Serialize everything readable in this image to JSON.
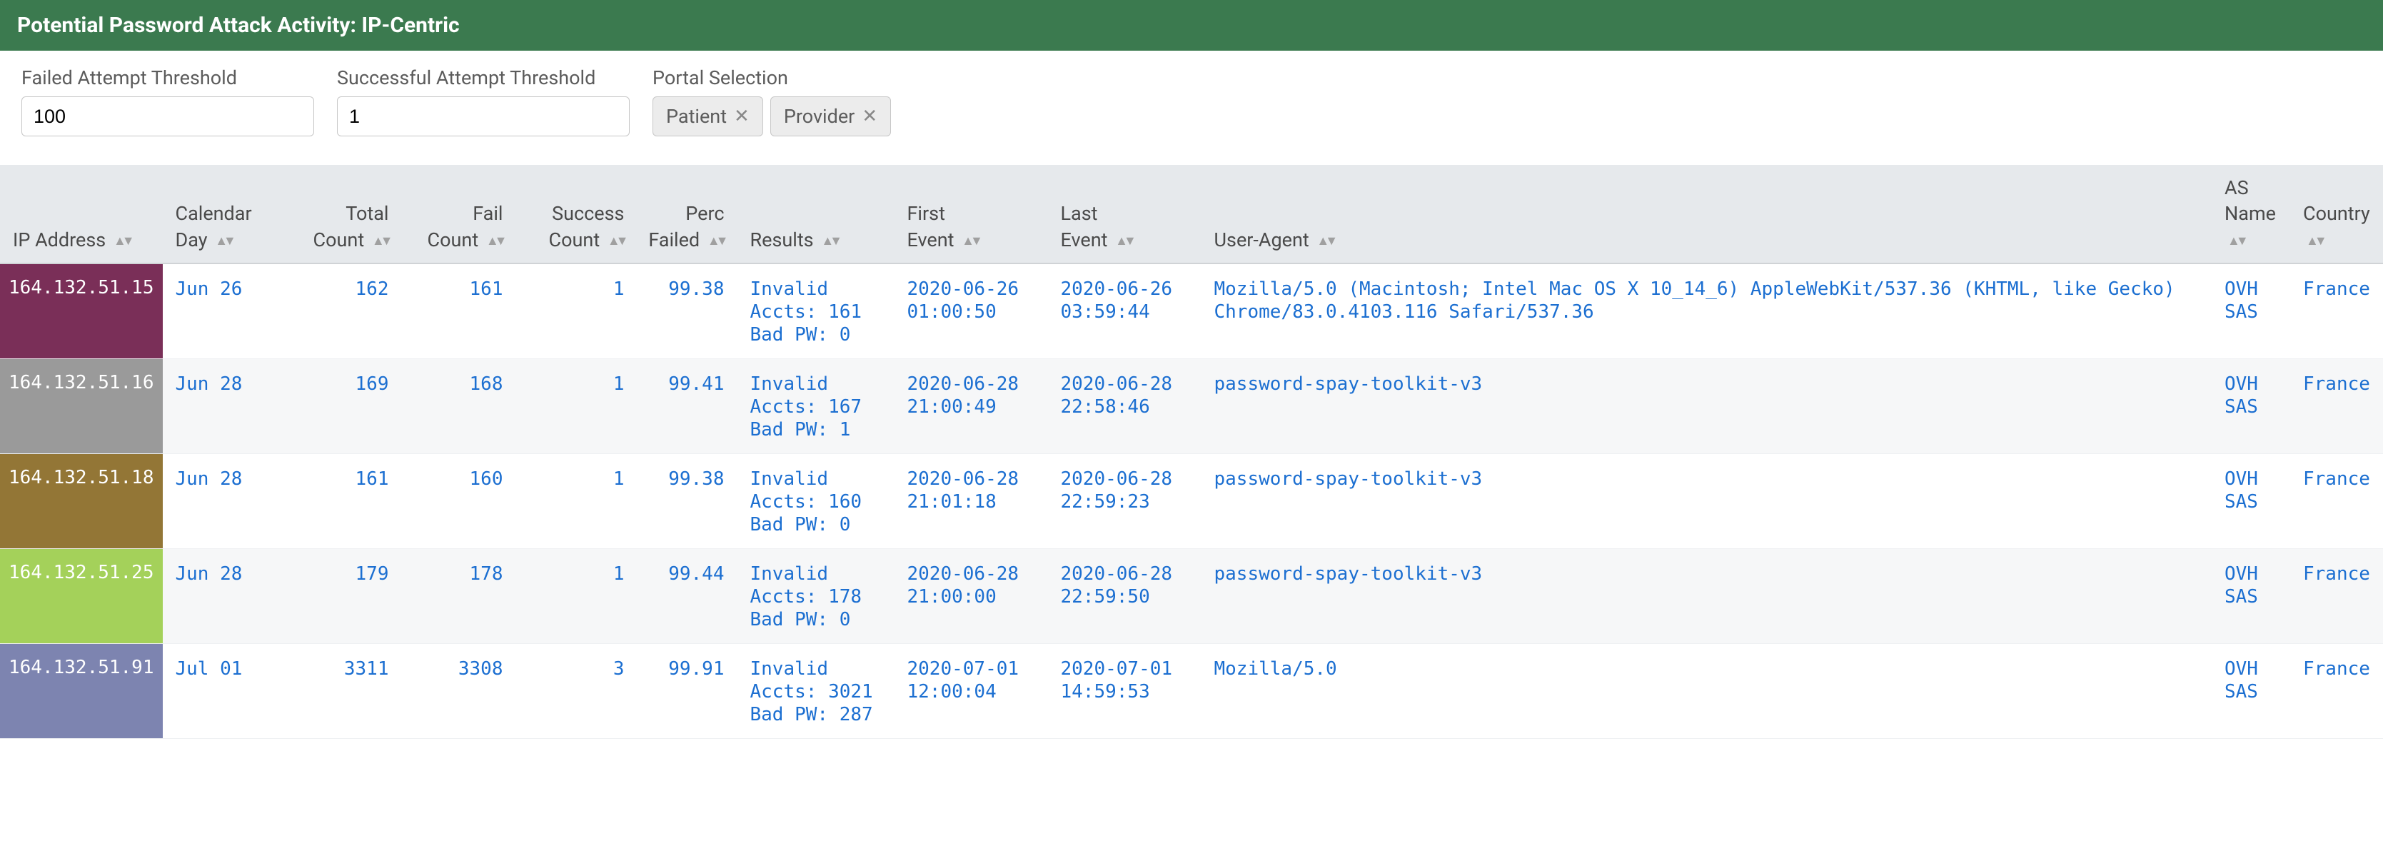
{
  "header": {
    "title": "Potential Password Attack Activity: IP-Centric"
  },
  "filters": {
    "failed": {
      "label": "Failed Attempt Threshold",
      "value": "100"
    },
    "successful": {
      "label": "Successful Attempt Threshold",
      "value": "1"
    },
    "portal": {
      "label": "Portal Selection",
      "chips": [
        {
          "label": "Patient"
        },
        {
          "label": "Provider"
        }
      ]
    }
  },
  "columns": [
    {
      "key": "ip",
      "label": "IP Address",
      "align": "left"
    },
    {
      "key": "day",
      "label": "Calendar Day",
      "align": "left"
    },
    {
      "key": "total",
      "label": "Total Count",
      "align": "right"
    },
    {
      "key": "fail",
      "label": "Fail Count",
      "align": "right"
    },
    {
      "key": "success",
      "label": "Success Count",
      "align": "right"
    },
    {
      "key": "perc",
      "label": "Perc Failed",
      "align": "right"
    },
    {
      "key": "results",
      "label": "Results",
      "align": "left"
    },
    {
      "key": "first",
      "label": "First Event",
      "align": "left"
    },
    {
      "key": "last",
      "label": "Last Event",
      "align": "left"
    },
    {
      "key": "ua",
      "label": "User-Agent",
      "align": "left"
    },
    {
      "key": "asname",
      "label": "AS Name",
      "align": "left"
    },
    {
      "key": "country",
      "label": "Country",
      "align": "left"
    }
  ],
  "ip_colors": {
    "164.132.51.15": "#7a2f58",
    "164.132.51.16": "#9a9a9a",
    "164.132.51.18": "#937636",
    "164.132.51.25": "#a4d15a",
    "164.132.51.91": "#7d84b0"
  },
  "rows": [
    {
      "ip": "164.132.51.15",
      "day": "Jun 26",
      "total": "162",
      "fail": "161",
      "success": "1",
      "perc": "99.38",
      "results": "Invalid Accts: 161\nBad PW: 0",
      "first": "2020-06-26 01:00:50",
      "last": "2020-06-26 03:59:44",
      "ua": "Mozilla/5.0 (Macintosh; Intel Mac OS X 10_14_6) AppleWebKit/537.36 (KHTML, like Gecko) Chrome/83.0.4103.116 Safari/537.36",
      "asname": "OVH SAS",
      "country": "France"
    },
    {
      "ip": "164.132.51.16",
      "day": "Jun 28",
      "total": "169",
      "fail": "168",
      "success": "1",
      "perc": "99.41",
      "results": "Invalid Accts: 167\nBad PW: 1",
      "first": "2020-06-28 21:00:49",
      "last": "2020-06-28 22:58:46",
      "ua": "password-spay-toolkit-v3",
      "asname": "OVH SAS",
      "country": "France"
    },
    {
      "ip": "164.132.51.18",
      "day": "Jun 28",
      "total": "161",
      "fail": "160",
      "success": "1",
      "perc": "99.38",
      "results": "Invalid Accts: 160\nBad PW: 0",
      "first": "2020-06-28 21:01:18",
      "last": "2020-06-28 22:59:23",
      "ua": "password-spay-toolkit-v3",
      "asname": "OVH SAS",
      "country": "France"
    },
    {
      "ip": "164.132.51.25",
      "day": "Jun 28",
      "total": "179",
      "fail": "178",
      "success": "1",
      "perc": "99.44",
      "results": "Invalid Accts: 178\nBad PW: 0",
      "first": "2020-06-28 21:00:00",
      "last": "2020-06-28 22:59:50",
      "ua": "password-spay-toolkit-v3",
      "asname": "OVH SAS",
      "country": "France"
    },
    {
      "ip": "164.132.51.91",
      "day": "Jul 01",
      "total": "3311",
      "fail": "3308",
      "success": "3",
      "perc": "99.91",
      "results": "Invalid Accts: 3021\nBad PW: 287",
      "first": "2020-07-01 12:00:04",
      "last": "2020-07-01 14:59:53",
      "ua": "Mozilla/5.0",
      "asname": "OVH SAS",
      "country": "France"
    }
  ]
}
